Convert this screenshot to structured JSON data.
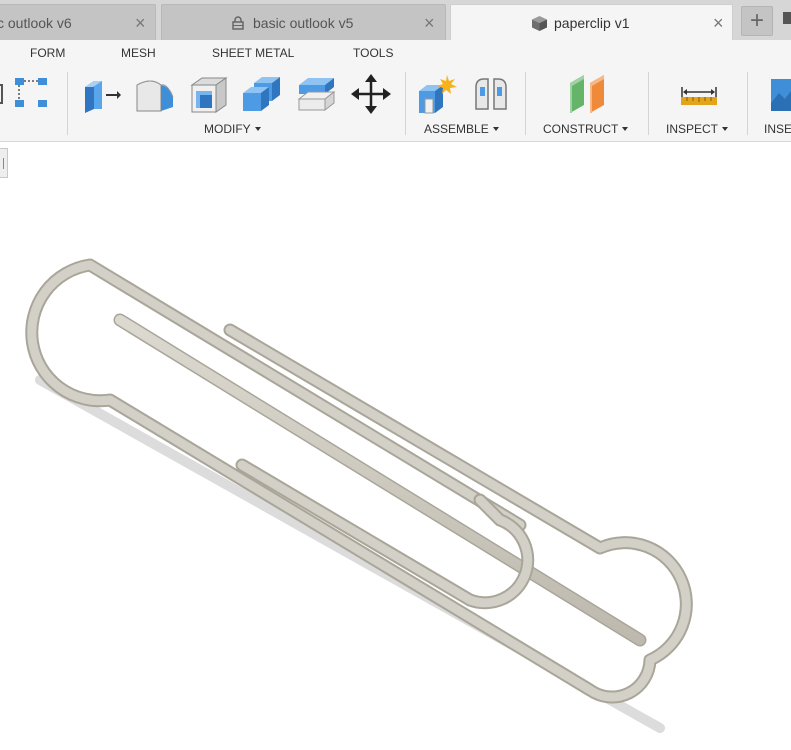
{
  "tabs": [
    {
      "title": "c outlook v6",
      "close": "×",
      "active": false,
      "locked": false
    },
    {
      "title": "basic outlook v5",
      "close": "×",
      "active": false,
      "locked": true
    },
    {
      "title": "paperclip v1",
      "close": "×",
      "active": true,
      "locked": false
    }
  ],
  "new_tab_symbol": "+",
  "menu": [
    "FORM",
    "MESH",
    "SHEET METAL",
    "TOOLS"
  ],
  "groups": [
    "MODIFY",
    "ASSEMBLE",
    "CONSTRUCT",
    "INSPECT",
    "INSE"
  ],
  "tool_icons": [
    "sketch-partial-icon",
    "sketch-dimension-icon",
    "press-pull-icon",
    "fillet-icon",
    "shell-icon",
    "combine-icon",
    "offset-face-icon",
    "move-icon",
    "new-component-icon",
    "joint-icon",
    "offset-plane-icon",
    "measure-icon",
    "insert-icon"
  ],
  "model": {
    "name": "paperclip",
    "color": "#c9c6bc",
    "shadow": "#d9d9d9"
  },
  "colors": {
    "accent_blue": "#3f8fd8",
    "plane_green": "#66b36a",
    "plane_orange": "#ef8a3a",
    "measure_yellow": "#e3a41b"
  }
}
